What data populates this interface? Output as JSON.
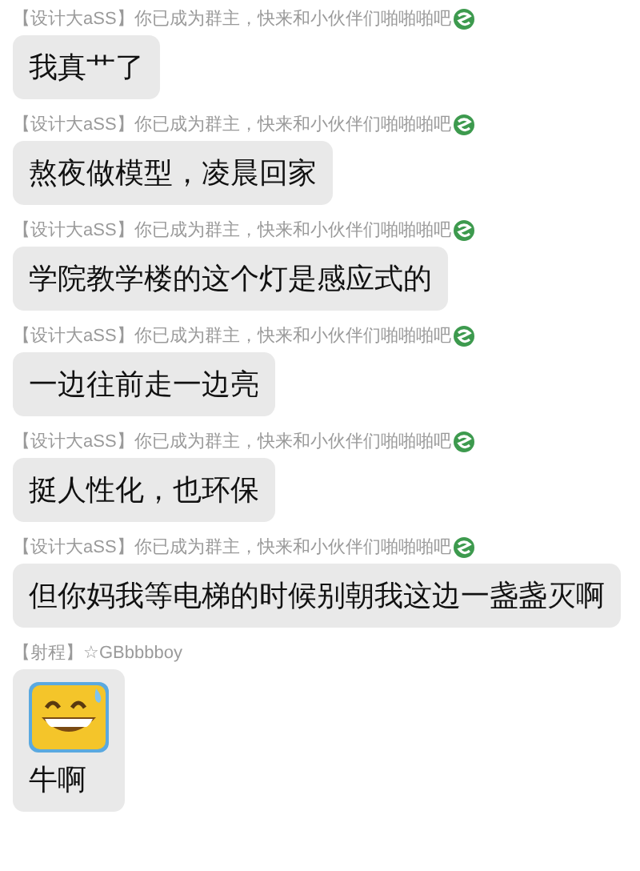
{
  "messages": [
    {
      "tag": "【设计大aSS】",
      "sender": "你已成为群主，快来和小伙伴们啪啪啪吧",
      "badge": true,
      "sticker": false,
      "text": "我真艹了"
    },
    {
      "tag": "【设计大aSS】",
      "sender": "你已成为群主，快来和小伙伴们啪啪啪吧",
      "badge": true,
      "sticker": false,
      "text": "熬夜做模型，凌晨回家"
    },
    {
      "tag": "【设计大aSS】",
      "sender": "你已成为群主，快来和小伙伴们啪啪啪吧",
      "badge": true,
      "sticker": false,
      "text": "学院教学楼的这个灯是感应式的"
    },
    {
      "tag": "【设计大aSS】",
      "sender": "你已成为群主，快来和小伙伴们啪啪啪吧",
      "badge": true,
      "sticker": false,
      "text": "一边往前走一边亮"
    },
    {
      "tag": "【设计大aSS】",
      "sender": "你已成为群主，快来和小伙伴们啪啪啪吧",
      "badge": true,
      "sticker": false,
      "text": "挺人性化，也环保"
    },
    {
      "tag": "【设计大aSS】",
      "sender": "你已成为群主，快来和小伙伴们啪啪啪吧",
      "badge": true,
      "sticker": false,
      "text": "但你妈我等电梯的时候别朝我这边一盏盏灭啊"
    },
    {
      "tag": "【射程】",
      "sender": "☆GBbbbboy",
      "badge": false,
      "sticker": true,
      "text": "牛啊"
    }
  ]
}
